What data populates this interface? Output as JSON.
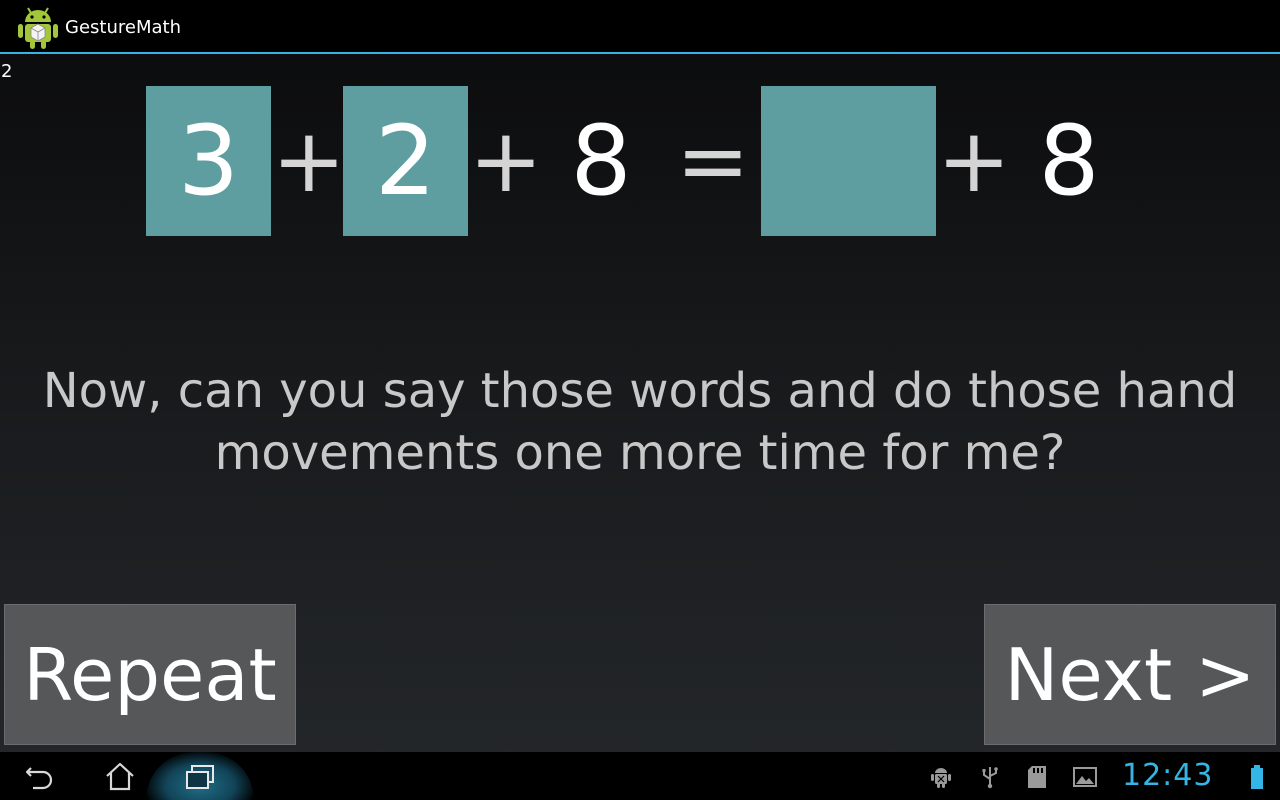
{
  "app": {
    "title": "GestureMath",
    "icon": "android-robot-icon",
    "accent_color": "#33b5e5"
  },
  "counter": "2",
  "equation": {
    "tile_color": "#5f9ea0",
    "left_terms": [
      "3",
      "2",
      "8"
    ],
    "left_operators": [
      "+",
      "+"
    ],
    "equals": "=",
    "answer_box": "",
    "right_operator": "+",
    "right_term": "8"
  },
  "prompt": {
    "line1": "Now, can you say those words and do those hand",
    "line2": "movements one more time for me?"
  },
  "buttons": {
    "repeat": "Repeat",
    "next": "Next >"
  },
  "system_bar": {
    "nav_icons": [
      "back-icon",
      "home-icon",
      "recent-apps-icon"
    ],
    "status_icons": [
      "android-debug-icon",
      "usb-icon",
      "sd-card-icon",
      "gallery-icon",
      "battery-icon"
    ],
    "clock": "12:43"
  }
}
